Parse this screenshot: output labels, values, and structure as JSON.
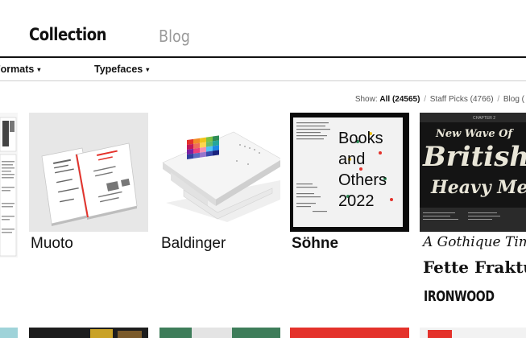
{
  "nav": {
    "collection": "Collection",
    "blog": "Blog"
  },
  "filters": {
    "formats": "Formats",
    "typefaces": "Typefaces",
    "arrow": "▾"
  },
  "show": {
    "label": "Show:",
    "all": "All (24565)",
    "staff_picks": "Staff Picks (4766)",
    "blog": "Blog (",
    "separator": "/"
  },
  "cards": [
    {
      "title": "Muoto"
    },
    {
      "title": "Baldinger"
    },
    {
      "title": "Söhne"
    }
  ],
  "sohne_poster": {
    "lines": [
      "Books",
      "and",
      "Others",
      "2022"
    ]
  },
  "gothic_card": {
    "fonts": [
      "A Gothique Time",
      "Fette Fraktur",
      "IRONWOOD"
    ],
    "poster_lines": [
      "New Wave Of",
      "British",
      "Heavy Metal"
    ],
    "chapter": "CHAPTER 2"
  },
  "colors": {
    "nav_active": "#111111",
    "nav_inactive": "#9a9a9a",
    "poster_red": "#e4322b",
    "poster_green": "#2e8b57",
    "poster_yellow": "#f0c419"
  }
}
